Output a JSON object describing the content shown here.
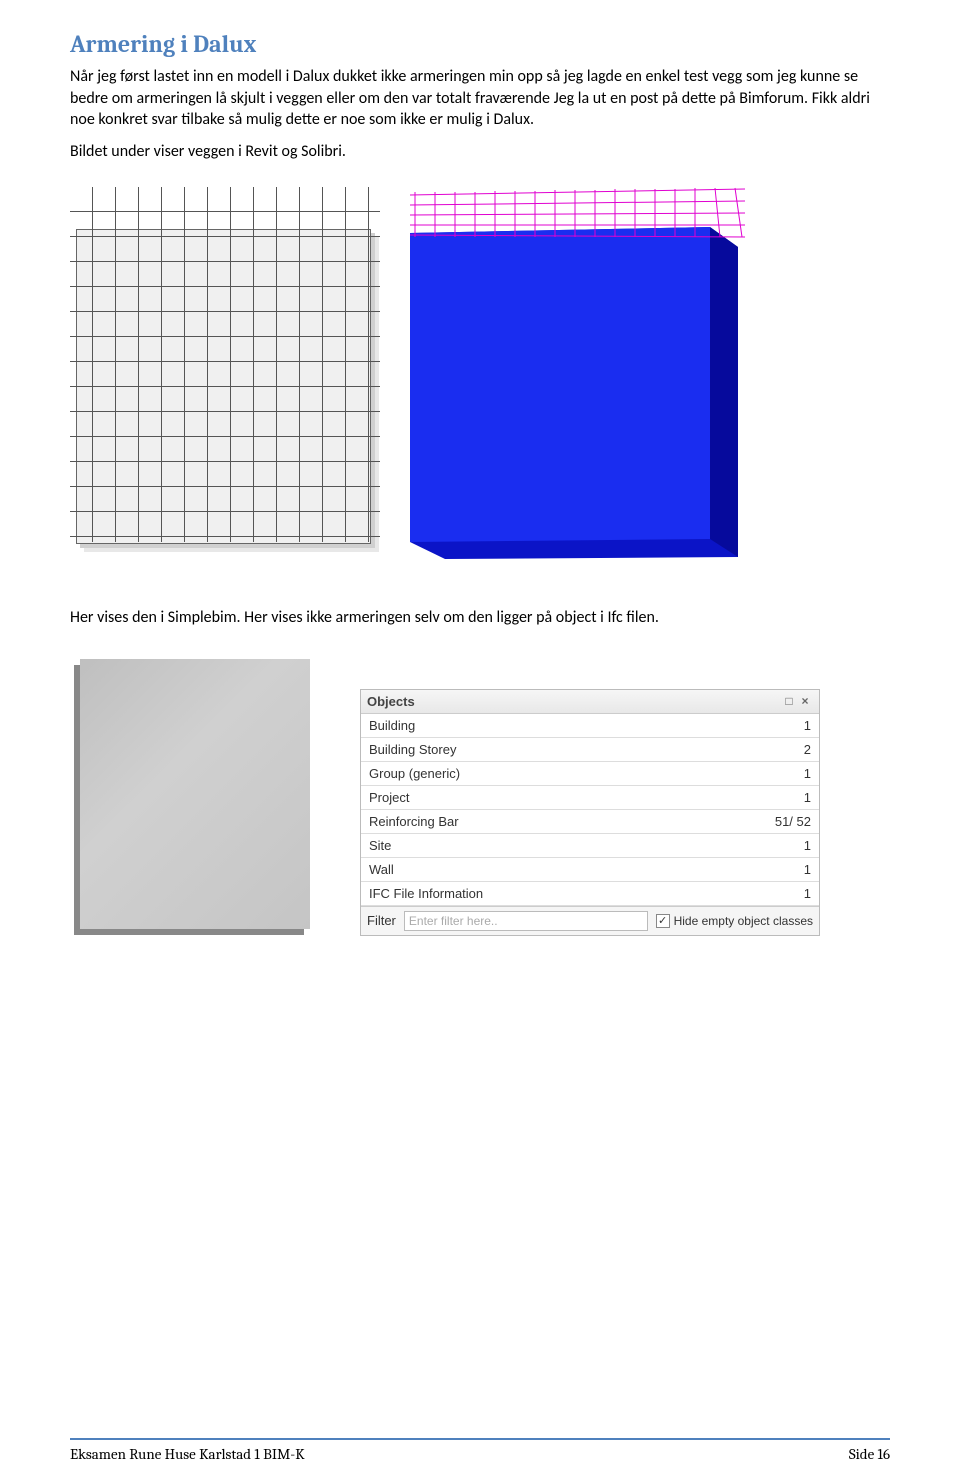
{
  "heading": "Armering i Dalux",
  "para1": " Når jeg først lastet inn en modell i Dalux dukket ikke armeringen min opp så jeg lagde en enkel test vegg som jeg kunne se bedre om armeringen lå skjult i veggen eller om den var totalt fraværende Jeg la ut en post på dette på Bimforum. Fikk aldri noe konkret svar tilbake så mulig dette er noe som ikke er mulig i Dalux.",
  "para2": "Bildet under viser veggen i Revit og Solibri.",
  "para3": "Her vises den i Simplebim. Her vises ikke armeringen selv om den ligger på object i Ifc filen.",
  "objects": {
    "title": "Objects",
    "rows": [
      {
        "name": "Building",
        "count": "1"
      },
      {
        "name": "Building Storey",
        "count": "2"
      },
      {
        "name": "Group (generic)",
        "count": "1"
      },
      {
        "name": "Project",
        "count": "1"
      },
      {
        "name": "Reinforcing Bar",
        "count": "51/ 52"
      },
      {
        "name": "Site",
        "count": "1"
      },
      {
        "name": "Wall",
        "count": "1"
      },
      {
        "name": "IFC File Information",
        "count": "1"
      }
    ],
    "filterLabel": "Filter",
    "filterPlaceholder": "Enter filter here..",
    "hideEmptyLabel": "Hide empty object classes"
  },
  "footer": {
    "left": "Eksamen Rune Huse Karlstad 1 BIM-K",
    "right": "Side 16"
  }
}
